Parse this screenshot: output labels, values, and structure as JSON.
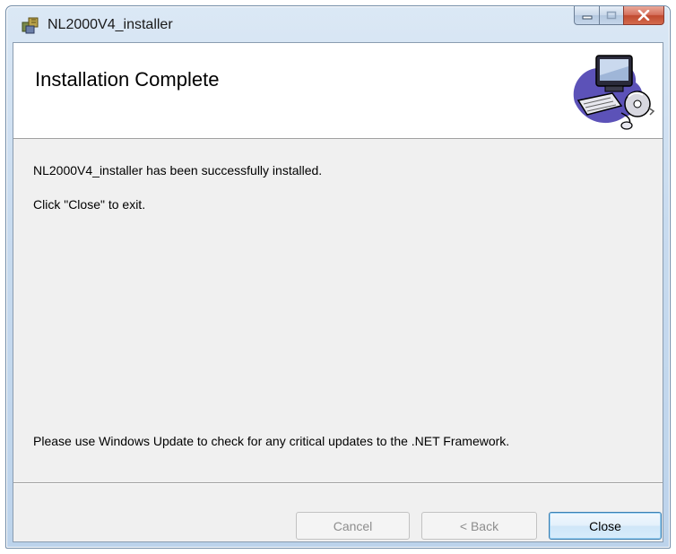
{
  "window": {
    "title": "NL2000V4_installer"
  },
  "banner": {
    "title": "Installation Complete",
    "art_icon": "computer-cd-icon"
  },
  "body": {
    "line1": "NL2000V4_installer has been successfully installed.",
    "line2": "Click \"Close\" to exit.",
    "line3": "Please use Windows Update to check for any critical updates to the .NET Framework."
  },
  "buttons": {
    "cancel_label": "Cancel",
    "back_label": "< Back",
    "close_label": "Close"
  },
  "colors": {
    "titlebar": "#c8dbef",
    "close_button": "#c04a30",
    "content_bg": "#f0f0f0",
    "banner_bg": "#ffffff",
    "default_button_border": "#3c7fb1"
  }
}
